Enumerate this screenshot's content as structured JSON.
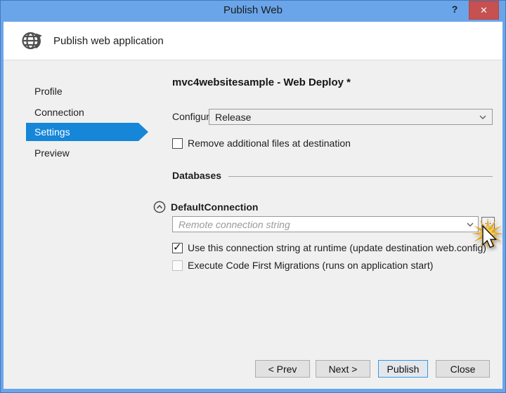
{
  "window": {
    "title": "Publish Web",
    "help_icon": "?",
    "close_icon": "✕"
  },
  "header": {
    "title": "Publish web application",
    "icon": "globe-with-arrow"
  },
  "sidebar": {
    "items": [
      {
        "label": "Profile",
        "selected": false
      },
      {
        "label": "Connection",
        "selected": false
      },
      {
        "label": "Settings",
        "selected": true
      },
      {
        "label": "Preview",
        "selected": false
      }
    ]
  },
  "main": {
    "profile_heading": "mvc4websitesample - Web Deploy *",
    "configuration": {
      "label": "Configuration:",
      "value": "Release"
    },
    "remove_files_checkbox": {
      "label": "Remove additional files at destination",
      "checked": false
    },
    "databases": {
      "section_title": "Databases",
      "connection_name": "DefaultConnection",
      "connection_placeholder": "Remote connection string",
      "browse_button_label": "...",
      "runtime_checkbox": {
        "label": "Use this connection string at runtime (update destination web.config)",
        "checked": true
      },
      "migrations_checkbox": {
        "label": "Execute Code First Migrations (runs on application start)",
        "checked": false,
        "disabled": true
      }
    }
  },
  "footer": {
    "prev_label": "< Prev",
    "next_label": "Next >",
    "publish_label": "Publish",
    "close_label": "Close"
  },
  "icons": {
    "checkmark": "✓",
    "cursor": "mouse-pointer",
    "starburst": "click-highlight",
    "chevron_down": "chevron-down",
    "chevron_up_circle": "chevron-up-circle"
  },
  "colors": {
    "titlebar": "#6aa5ea",
    "selected_item": "#1586d8",
    "close_button": "#c75050",
    "default_button_border": "#3897e2",
    "body_background": "#f0f0f0"
  }
}
